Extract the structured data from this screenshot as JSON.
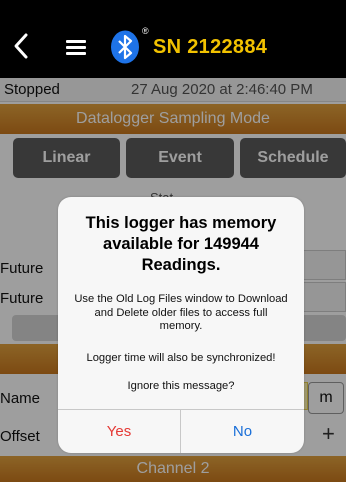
{
  "header": {
    "device_name": "SN 2122884",
    "registered_mark": "®",
    "icons": [
      "chevron-left-icon",
      "menu-icon",
      "bluetooth-icon"
    ],
    "accent_color": "#f2c200"
  },
  "status_row": {
    "status": "Stopped",
    "datetime": "27 Aug 2020 at 2:46:40 PM"
  },
  "mode_bar": {
    "title": "Datalogger Sampling Mode"
  },
  "tabs": [
    {
      "label": "Linear"
    },
    {
      "label": "Event"
    },
    {
      "label": "Schedule"
    }
  ],
  "background": {
    "sub_label": "Stat",
    "future_label_1": "Future",
    "future_label_2": "Future",
    "name_label": "Name",
    "offset_label": "Offset",
    "unit_box": "m",
    "plus": "+",
    "channel_bar": "Channel 2"
  },
  "dialog": {
    "title": "This logger has memory available for 149944 Readings.",
    "body": "Use the Old Log Files window to Download and Delete older files to access full memory.",
    "sync_note": "Logger time will also be synchronized!",
    "question": "Ignore this message?",
    "yes_label": "Yes",
    "no_label": "No",
    "yes_color": "#e53935",
    "no_color": "#1a6fd8"
  }
}
